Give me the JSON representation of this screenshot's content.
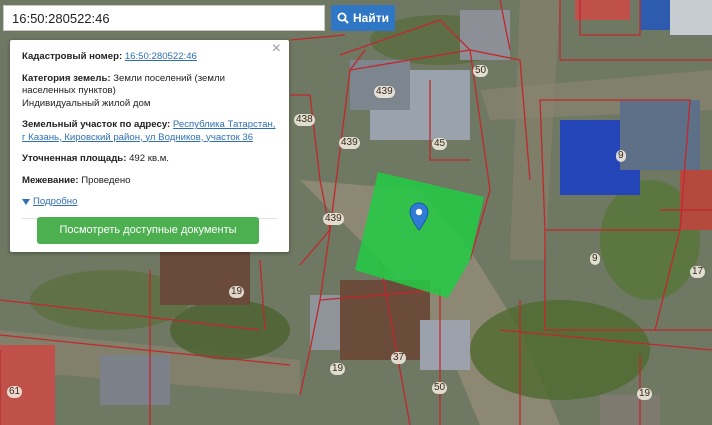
{
  "search": {
    "value": "16:50:280522:46",
    "button_label": "Найти"
  },
  "popup": {
    "cadastral_label": "Кадастровый номер:",
    "cadastral_value": "16:50:280522:46",
    "category_label": "Категория земель:",
    "category_value": "Земли поселений (земли населенных пунктов)",
    "use_value": "Индивидуальный жилой дом",
    "address_label": "Земельный участок по адресу:",
    "address_value": "Республика Татарстан, г Казань, Кировский район, ул Водников, участок 36",
    "area_label": "Уточненная площадь:",
    "area_value": "492 кв.м.",
    "survey_label": "Межевание:",
    "survey_value": "Проведено",
    "more_label": "Подробно",
    "docs_button": "Посмотреть доступные документы"
  },
  "map": {
    "plot_numbers": [
      "439",
      "50",
      "438",
      "45",
      "439",
      "9",
      "439",
      "9",
      "17",
      "19",
      "37",
      "50",
      "61",
      "19",
      "19"
    ],
    "highlight_color": "#22cc44",
    "boundary_color": "#c0282d"
  }
}
